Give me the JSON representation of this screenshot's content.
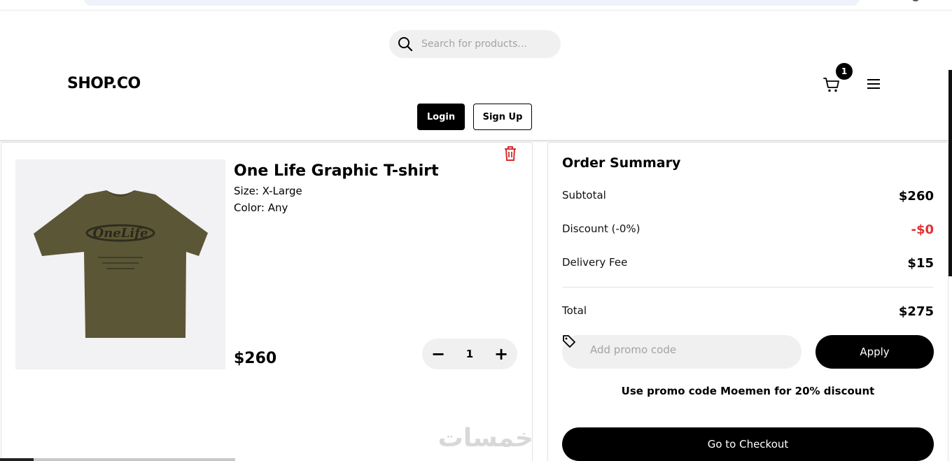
{
  "header": {
    "search_placeholder": "Search for products...",
    "logo": "SHOP.CO",
    "cart_count": "1",
    "login_label": "Login",
    "signup_label": "Sign Up"
  },
  "cart": {
    "items": [
      {
        "name": "One Life Graphic T-shirt",
        "size": "Size: X-Large",
        "color": "Color: Any",
        "price": "$260",
        "quantity": "1",
        "shirt_color": "#5b5736"
      }
    ],
    "minus_symbol": "−",
    "plus_symbol": "+"
  },
  "summary": {
    "title": "Order Summary",
    "rows": [
      {
        "label": "Subtotal",
        "value": "$260"
      },
      {
        "label": "Discount (-0%)",
        "value": "-$0"
      },
      {
        "label": "Delivery Fee",
        "value": "$15"
      }
    ],
    "total_label": "Total",
    "total_value": "$275",
    "promo_placeholder": "Add promo code",
    "apply_label": "Apply",
    "promo_hint": "Use promo code Moemen for 20% discount",
    "checkout_label": "Go to Checkout"
  },
  "watermark": "خمسات",
  "colors": {
    "accent": "#000000",
    "discount": "#e03333",
    "delete": "#d32f2f",
    "input_bg": "#f0f0f0"
  },
  "icons": {
    "search": "search-icon",
    "cart": "cart-icon",
    "menu": "hamburger-menu-icon",
    "delete": "trash-icon",
    "promo": "tag-icon"
  }
}
